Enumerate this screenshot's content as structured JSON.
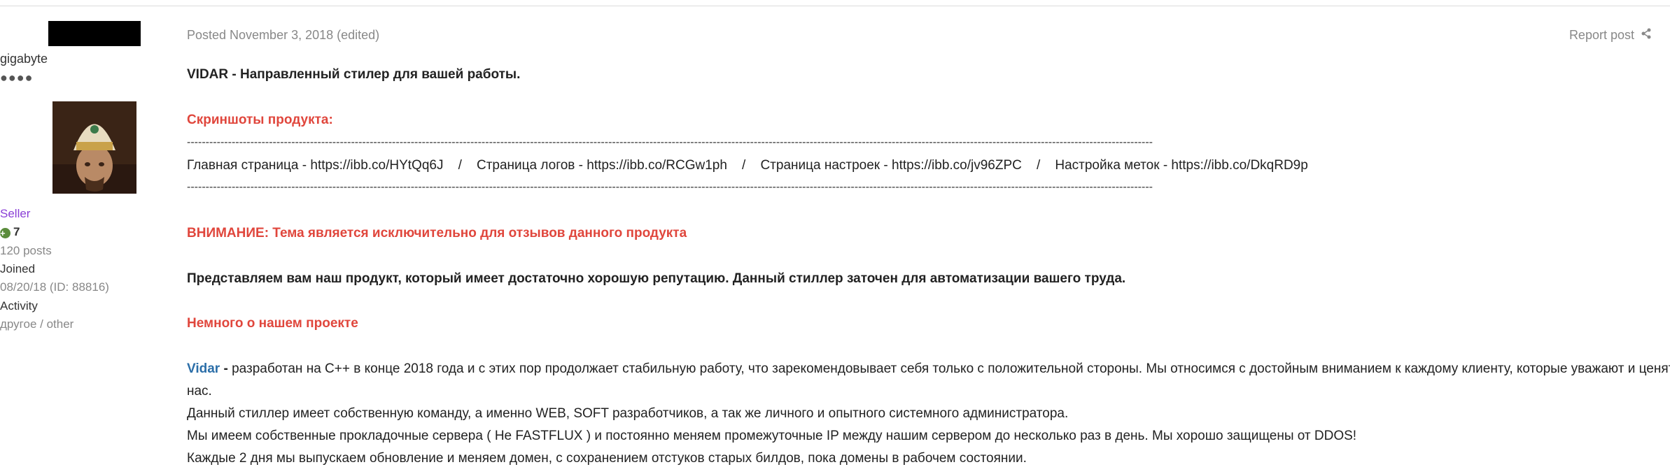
{
  "author": {
    "username": "gigabyte",
    "rank_dots": "●●●●",
    "group": "Seller",
    "reputation": "7",
    "posts": "120 posts",
    "joined_label": "Joined",
    "joined_value": "08/20/18 (ID: 88816)",
    "activity_label": "Activity",
    "activity_value": "другое / other"
  },
  "post": {
    "meta": "Posted November 3, 2018 (edited)",
    "report_label": "Report post",
    "title": "VIDAR - Направленный стилер для вашей работы.",
    "screenshots_heading": "Скриншоты продукта:",
    "divider": "-----------------------------------------------------------------------------------------------------------------------------------------------------------------------------------------------------------------------------------------------------------------------------------------------------------------",
    "links_line": "Главная страница - https://ibb.co/HYtQq6J    /    Страница логов - https://ibb.co/RCGw1ph    /    Страница настроек - https://ibb.co/jv96ZPC    /    Настройка меток - https://ibb.co/DkqRD9p",
    "warning": "ВНИМАНИЕ: Тема является исключительно для отзывов данного продукта",
    "intro": "Представляем вам наш продукт, который имеет достаточно хорошую репутацию. Данный стиллер заточен для автоматизации вашего труда.",
    "about_heading": "Немного о нашем проекте",
    "vidar_word": "Vidar",
    "vidar_dash": " - ",
    "paragraph_1": "разработан на C++ в конце 2018 года и с этих пор продолжает стабильную работу, что зарекомендовывает себя только с положительной стороны. Мы относимся с достойным вниманием к каждому клиенту, которые уважают и ценят",
    "paragraph_1_cont": "нас.",
    "paragraph_2": "Данный стиллер имеет собственную команду, а именно WEB, SOFT разработчиков, а так же личного и опытного системного администратора.",
    "paragraph_3": "Мы имеем собственные прокладочные сервера ( Не FASTFLUX ) и постоянно меняем промежуточные IP между нашим сервером до несколько раз в день. Мы хорошо защищены от DDOS!",
    "paragraph_4": "Каждые 2 дня мы выпускаем обновление и меняем домен, с сохранением отстуков старых билдов, пока домены в рабочем состоянии."
  },
  "icons": {
    "share": "share-icon",
    "reputation": "plus-circle-icon"
  },
  "colors": {
    "accent_red": "#e0463c",
    "link_blue": "#2b6ea8",
    "group_purple": "#8a3fd6"
  }
}
